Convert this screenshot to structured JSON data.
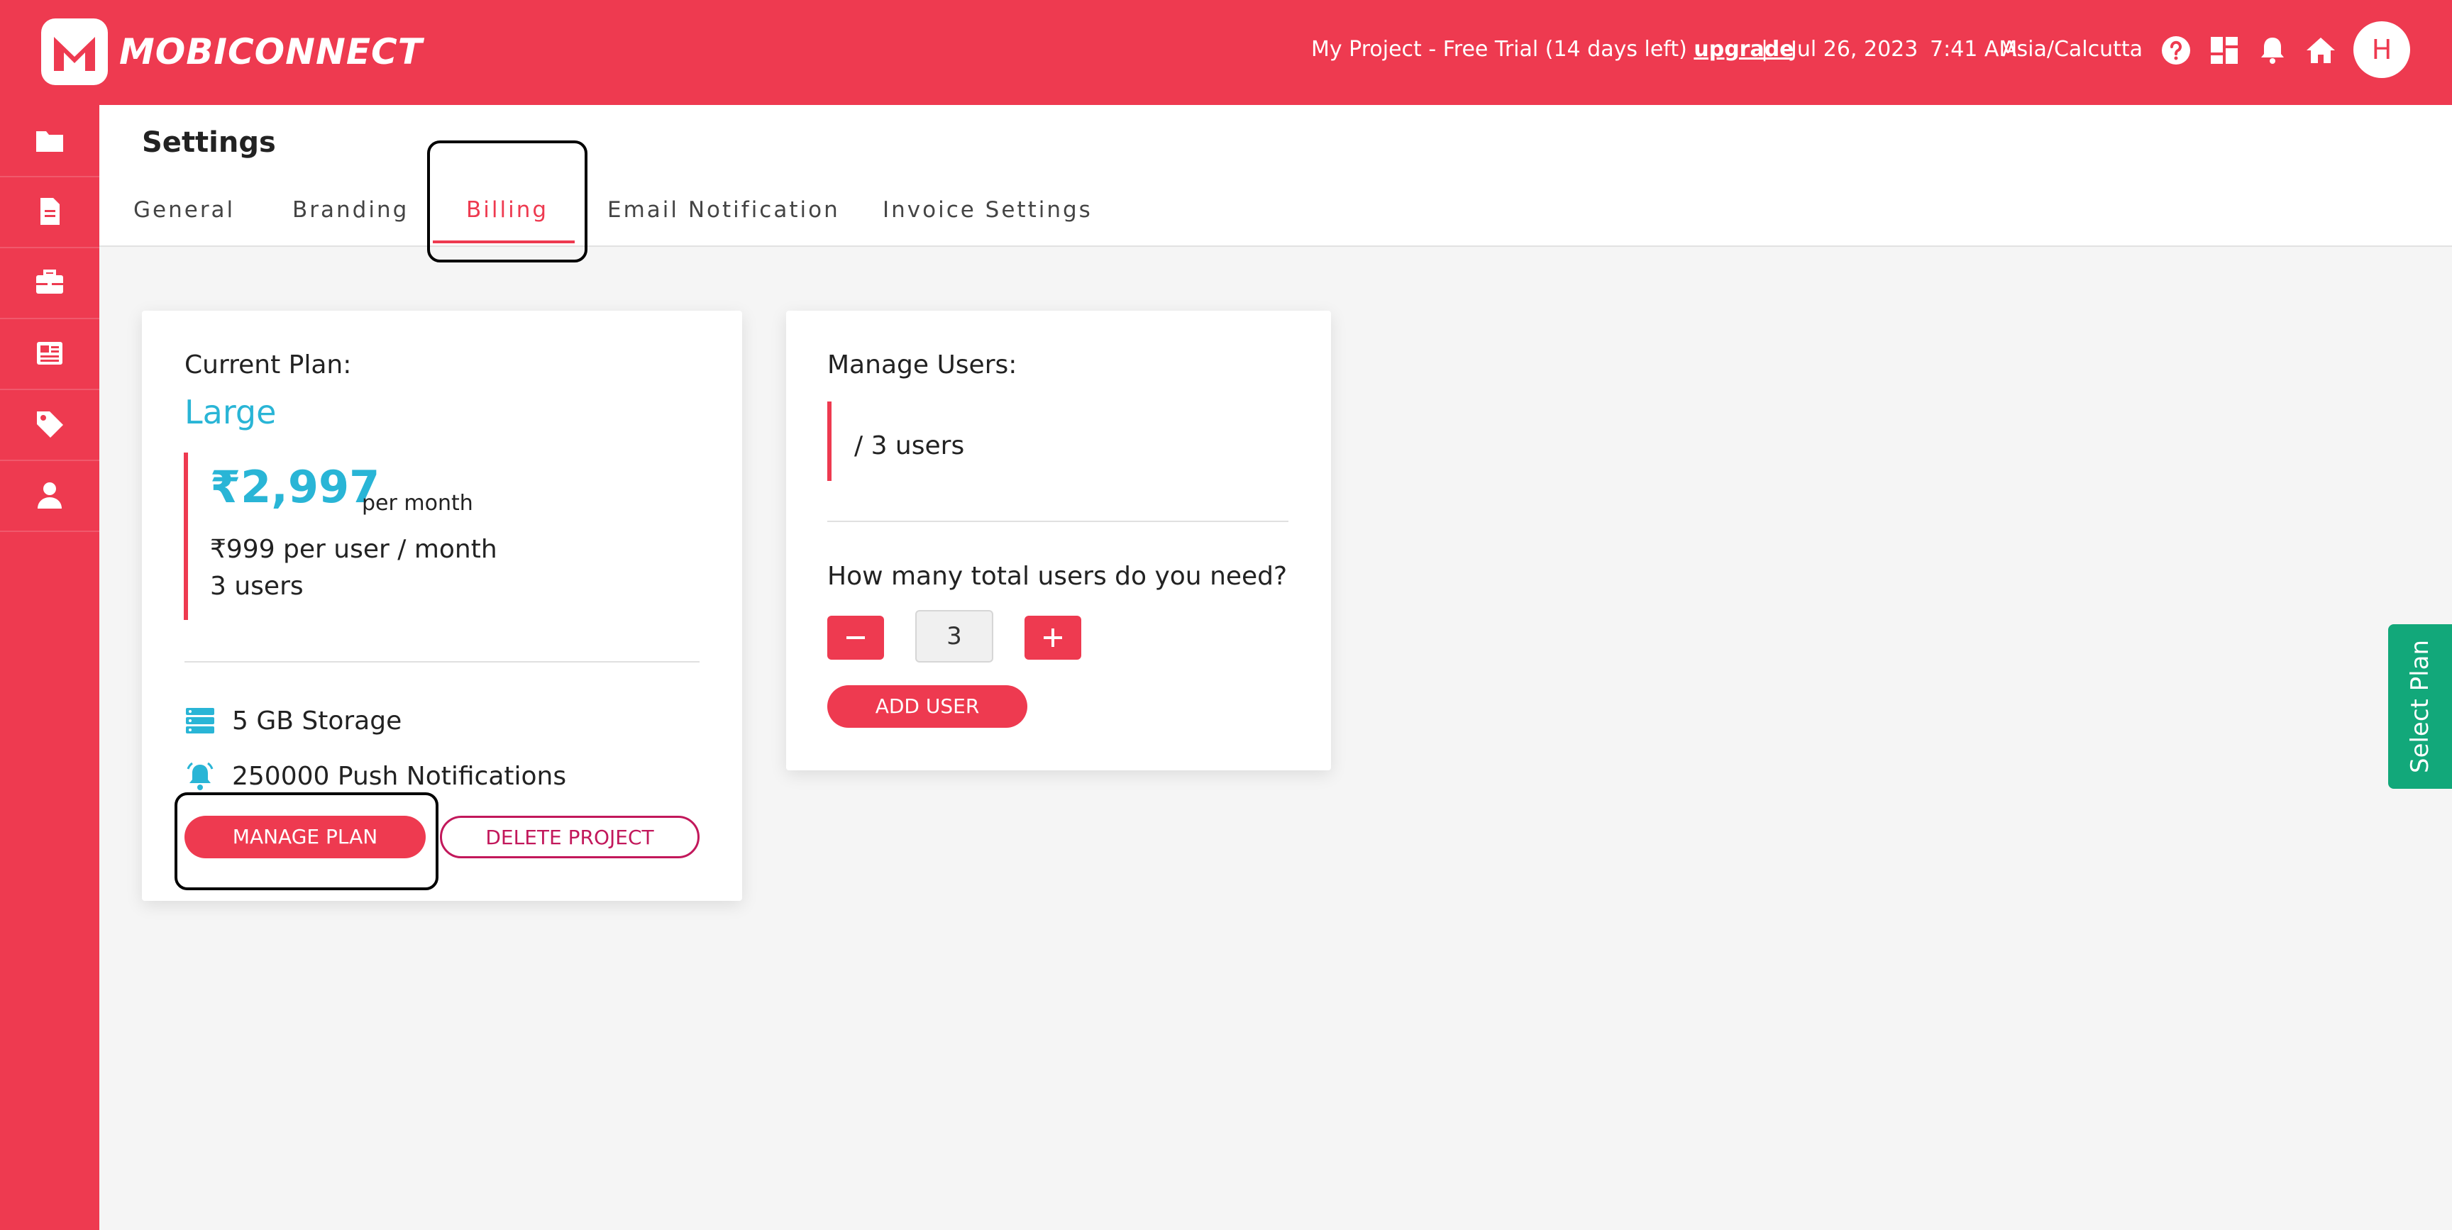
{
  "brand": {
    "name": "MOBICONNECT",
    "logo_letter": "M"
  },
  "topbar": {
    "project": "My Project - Free Trial (14 days left)",
    "upgrade": "upgrade",
    "separator": "|",
    "date": "Jul 26, 2023",
    "time": "7:41 AM",
    "timezone": "Asia/Calcutta",
    "avatar_initial": "H",
    "icons": [
      "help-icon",
      "dashboard-icon",
      "bell-icon",
      "home-icon"
    ]
  },
  "sidebar": {
    "items": [
      "folder-icon",
      "document-icon",
      "briefcase-icon",
      "newspaper-icon",
      "tag-icon",
      "user-icon"
    ]
  },
  "settings": {
    "title": "Settings",
    "tabs": [
      "General",
      "Branding",
      "Billing",
      "Email Notification",
      "Invoice Settings"
    ],
    "active_tab": "Billing"
  },
  "current_plan": {
    "heading": "Current Plan:",
    "plan": "Large",
    "price": "₹2,997",
    "period": "per month",
    "per_user": "₹999 per user / month",
    "users": "3 users",
    "features": [
      "5 GB Storage",
      "250000 Push Notifications"
    ],
    "manage_button": "MANAGE PLAN",
    "delete_button": "DELETE PROJECT"
  },
  "manage_users": {
    "heading": "Manage Users:",
    "count": "/ 3 users",
    "question": "How many total users do you need?",
    "quantity": "3",
    "add_button": "ADD USER"
  },
  "select_plan_tab": "Select Plan",
  "colors": {
    "primary": "#ee3a50",
    "accent": "#29b5d6",
    "select": "#12a87a",
    "outline": "#c2185b"
  }
}
